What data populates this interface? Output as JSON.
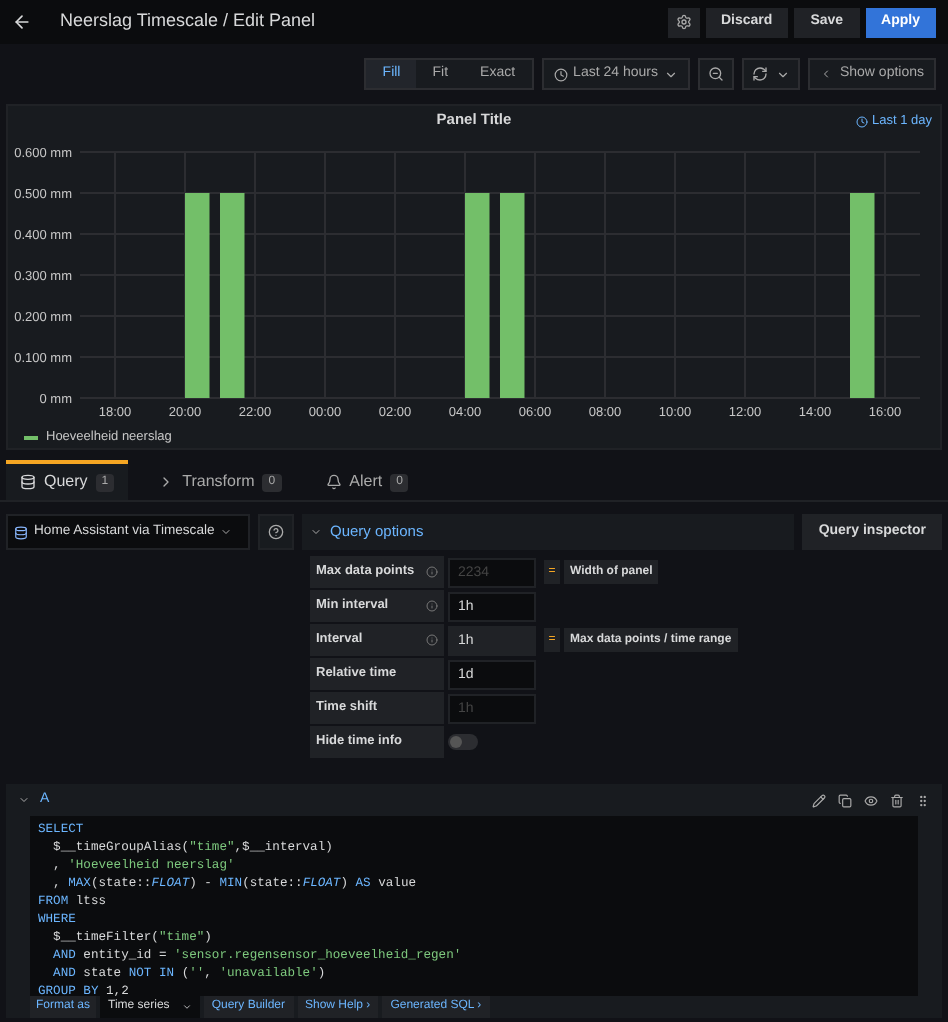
{
  "header": {
    "title": "Neerslag Timescale / Edit Panel",
    "buttons": [
      {
        "label": "Discard",
        "kind": "secondary"
      },
      {
        "label": "Save",
        "kind": "secondary"
      },
      {
        "label": "Apply",
        "kind": "primary"
      }
    ]
  },
  "toolbar": {
    "modes": [
      {
        "label": "Fill",
        "selected": true
      },
      {
        "label": "Fit",
        "selected": false
      },
      {
        "label": "Exact",
        "selected": false
      }
    ],
    "time_range": "Last 24 hours",
    "show_options": "Show options"
  },
  "panel": {
    "title": "Panel Title",
    "time_info": "Last 1 day",
    "chart_data": {
      "type": "bar",
      "categories": [
        "18:00",
        null,
        "20:00",
        null,
        "22:00",
        null,
        "00:00",
        null,
        "02:00",
        null,
        "04:00",
        null,
        "06:00",
        null,
        "08:00",
        null,
        "10:00",
        null,
        "12:00",
        null,
        "14:00",
        null,
        "16:00"
      ],
      "series": [
        {
          "name": "Hoeveelheid neerslag",
          "color": "#73bf69",
          "values": [
            0,
            0,
            0.5,
            0.5,
            0,
            0,
            0,
            0,
            0,
            0,
            0.5,
            0.5,
            0,
            0,
            0,
            0,
            0,
            0,
            0,
            0,
            0,
            0.5,
            0
          ]
        }
      ],
      "ylim": [
        0,
        0.6
      ],
      "grid": true,
      "yticks": [
        {
          "value": 0,
          "label": "0 mm"
        },
        {
          "value": 0.1,
          "label": "0.100 mm"
        },
        {
          "value": 0.2,
          "label": "0.200 mm"
        },
        {
          "value": 0.3,
          "label": "0.300 mm"
        },
        {
          "value": 0.4,
          "label": "0.400 mm"
        },
        {
          "value": 0.5,
          "label": "0.500 mm"
        },
        {
          "value": 0.6,
          "label": "0.600 mm"
        }
      ]
    }
  },
  "tabs": [
    {
      "label": "Query",
      "count": "1",
      "selected": true
    },
    {
      "label": "Transform",
      "count": "0",
      "selected": false
    },
    {
      "label": "Alert",
      "count": "0",
      "selected": false
    }
  ],
  "query_row": {
    "datasource": "Home Assistant via Timescale",
    "options_label": "Query options",
    "inspector": "Query inspector"
  },
  "options": [
    {
      "kind": "input",
      "label": "Max data points",
      "info": true,
      "placeholder": "2234",
      "operator": "=",
      "note": "Width of panel"
    },
    {
      "kind": "input",
      "label": "Min interval",
      "info": true,
      "value": "1h"
    },
    {
      "kind": "readonly",
      "label": "Interval",
      "info": true,
      "value": "1h",
      "operator": "=",
      "note": "Max data points / time range"
    },
    {
      "kind": "input",
      "label": "Relative time",
      "info": false,
      "value": "1d"
    },
    {
      "kind": "input",
      "label": "Time shift",
      "info": false,
      "placeholder": "1h"
    },
    {
      "kind": "switch",
      "label": "Hide time info",
      "info": false,
      "on": false
    }
  ],
  "query": {
    "ref": "A",
    "expanded": true,
    "code": [
      [
        {
          "kind": "keyword",
          "text": "SELECT"
        }
      ],
      [
        {
          "kind": "plain",
          "text": "  $__timeGroupAlias("
        },
        {
          "kind": "string",
          "text": "\"time\""
        },
        {
          "kind": "plain",
          "text": ",$__interval)"
        }
      ],
      [
        {
          "kind": "plain",
          "text": "  , "
        },
        {
          "kind": "string",
          "text": "'Hoeveelheid neerslag'"
        }
      ],
      [
        {
          "kind": "plain",
          "text": "  , "
        },
        {
          "kind": "keyword",
          "text": "MAX"
        },
        {
          "kind": "plain",
          "text": "(state::"
        },
        {
          "kind": "type",
          "text": "FLOAT"
        },
        {
          "kind": "plain",
          "text": ") - "
        },
        {
          "kind": "keyword",
          "text": "MIN"
        },
        {
          "kind": "plain",
          "text": "(state::"
        },
        {
          "kind": "type",
          "text": "FLOAT"
        },
        {
          "kind": "plain",
          "text": ") "
        },
        {
          "kind": "keyword",
          "text": "AS"
        },
        {
          "kind": "plain",
          "text": " value"
        }
      ],
      [
        {
          "kind": "keyword",
          "text": "FROM"
        },
        {
          "kind": "plain",
          "text": " ltss"
        }
      ],
      [
        {
          "kind": "keyword",
          "text": "WHERE"
        }
      ],
      [
        {
          "kind": "plain",
          "text": "  $__timeFilter("
        },
        {
          "kind": "string",
          "text": "\"time\""
        },
        {
          "kind": "plain",
          "text": ")"
        }
      ],
      [
        {
          "kind": "keyword",
          "text": "  AND"
        },
        {
          "kind": "plain",
          "text": " entity_id = "
        },
        {
          "kind": "string",
          "text": "'sensor.regensensor_hoeveelheid_regen'"
        }
      ],
      [
        {
          "kind": "keyword",
          "text": "  AND"
        },
        {
          "kind": "plain",
          "text": " state "
        },
        {
          "kind": "keyword",
          "text": "NOT IN"
        },
        {
          "kind": "plain",
          "text": " ("
        },
        {
          "kind": "string",
          "text": "''"
        },
        {
          "kind": "plain",
          "text": ", "
        },
        {
          "kind": "string",
          "text": "'unavailable'"
        },
        {
          "kind": "plain",
          "text": ")"
        }
      ],
      [
        {
          "kind": "keyword",
          "text": "GROUP BY"
        },
        {
          "kind": "plain",
          "text": " 1,2"
        }
      ]
    ],
    "footer": [
      {
        "kind": "label",
        "text": "Format as"
      },
      {
        "kind": "select",
        "text": "Time series"
      },
      {
        "kind": "link",
        "text": "Query Builder"
      },
      {
        "kind": "link",
        "text": "Show Help ›"
      },
      {
        "kind": "link",
        "text": "Generated SQL ›"
      }
    ]
  }
}
